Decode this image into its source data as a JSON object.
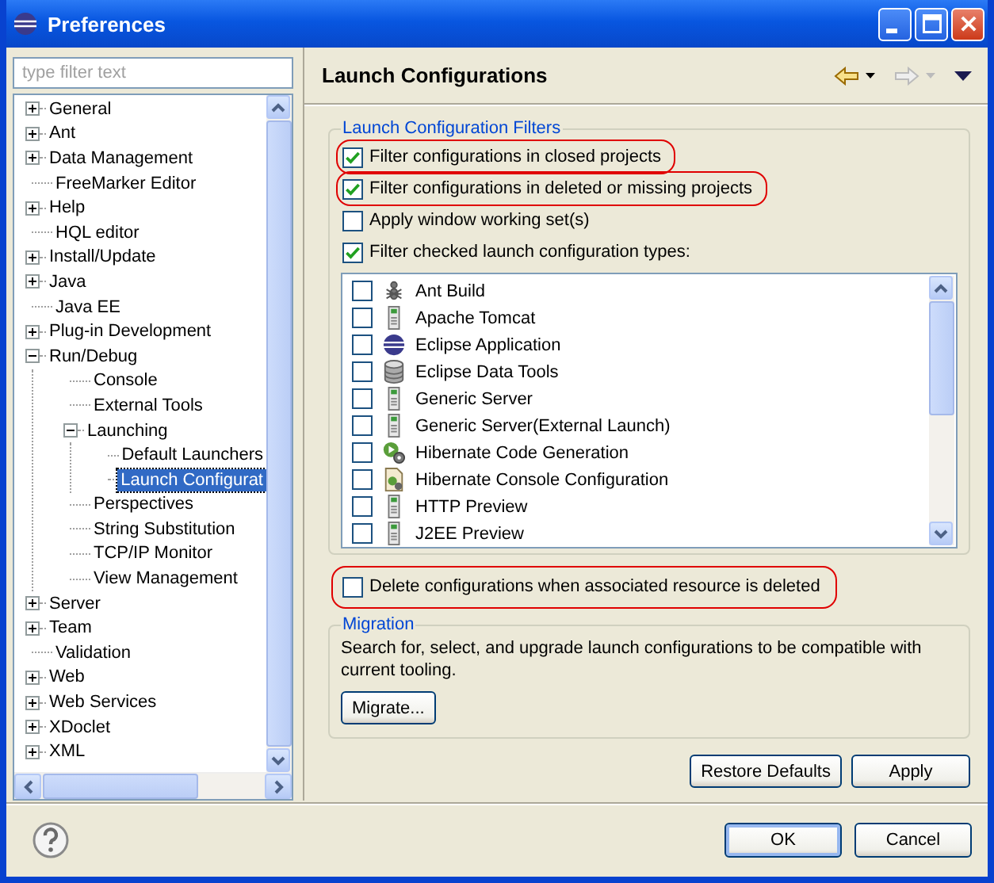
{
  "window": {
    "title": "Preferences"
  },
  "filter": {
    "placeholder": "type filter text"
  },
  "tree": [
    {
      "label": "General",
      "expanded": false,
      "selected": false
    },
    {
      "label": "Ant",
      "expanded": false,
      "selected": false
    },
    {
      "label": "Data Management",
      "expanded": false,
      "selected": false
    },
    {
      "label": "FreeMarker Editor",
      "selected": false
    },
    {
      "label": "Help",
      "expanded": false,
      "selected": false
    },
    {
      "label": "HQL editor",
      "selected": false
    },
    {
      "label": "Install/Update",
      "expanded": false,
      "selected": false
    },
    {
      "label": "Java",
      "expanded": false,
      "selected": false
    },
    {
      "label": "Java EE",
      "selected": false
    },
    {
      "label": "Plug-in Development",
      "expanded": false,
      "selected": false
    },
    {
      "label": "Run/Debug",
      "expanded": true,
      "selected": false,
      "children": [
        {
          "label": "Console",
          "selected": false
        },
        {
          "label": "External Tools",
          "selected": false
        },
        {
          "label": "Launching",
          "expanded": true,
          "selected": false,
          "children": [
            {
              "label": "Default Launchers",
              "selected": false
            },
            {
              "label": "Launch Configurat",
              "selected": true
            }
          ]
        },
        {
          "label": "Perspectives",
          "selected": false
        },
        {
          "label": "String Substitution",
          "selected": false
        },
        {
          "label": "TCP/IP Monitor",
          "selected": false
        },
        {
          "label": "View Management",
          "selected": false
        }
      ]
    },
    {
      "label": "Server",
      "expanded": false,
      "selected": false
    },
    {
      "label": "Team",
      "expanded": false,
      "selected": false
    },
    {
      "label": "Validation",
      "selected": false
    },
    {
      "label": "Web",
      "expanded": false,
      "selected": false
    },
    {
      "label": "Web Services",
      "expanded": false,
      "selected": false
    },
    {
      "label": "XDoclet",
      "expanded": false,
      "selected": false
    },
    {
      "label": "XML",
      "expanded": false,
      "selected": false
    }
  ],
  "page": {
    "title": "Launch Configurations",
    "back_disabled": false,
    "forward_disabled": true
  },
  "filters_group": {
    "title": "Launch Configuration Filters",
    "options": [
      {
        "label": "Filter configurations in closed projects",
        "checked": true,
        "highlighted": true
      },
      {
        "label": "Filter configurations in deleted or missing projects",
        "checked": true,
        "highlighted": true
      },
      {
        "label": "Apply window working set(s)",
        "checked": false,
        "highlighted": false
      },
      {
        "label": "Filter checked launch configuration types:",
        "checked": true,
        "highlighted": false
      }
    ]
  },
  "config_types": [
    {
      "label": "Ant Build",
      "kind": "ant",
      "checked": false
    },
    {
      "label": "Apache Tomcat",
      "kind": "server",
      "checked": false
    },
    {
      "label": "Eclipse Application",
      "kind": "sphere",
      "checked": false
    },
    {
      "label": "Eclipse Data Tools",
      "kind": "database",
      "checked": false
    },
    {
      "label": "Generic Server",
      "kind": "server",
      "checked": false
    },
    {
      "label": "Generic Server(External Launch)",
      "kind": "server",
      "checked": false
    },
    {
      "label": "Hibernate Code Generation",
      "kind": "codegen",
      "checked": false
    },
    {
      "label": "Hibernate Console Configuration",
      "kind": "console",
      "checked": false
    },
    {
      "label": "HTTP Preview",
      "kind": "server",
      "checked": false
    },
    {
      "label": "J2EE Preview",
      "kind": "server",
      "checked": false
    }
  ],
  "delete_option": {
    "label": "Delete configurations when associated resource is deleted",
    "checked": false,
    "highlighted": true
  },
  "migration": {
    "title": "Migration",
    "description": "Search for, select, and upgrade launch configurations to be compatible with current tooling.",
    "button": "Migrate..."
  },
  "page_buttons": [
    "Restore Defaults",
    "Apply"
  ],
  "dialog_buttons": [
    {
      "label": "OK",
      "default": true
    },
    {
      "label": "Cancel",
      "default": false
    }
  ]
}
